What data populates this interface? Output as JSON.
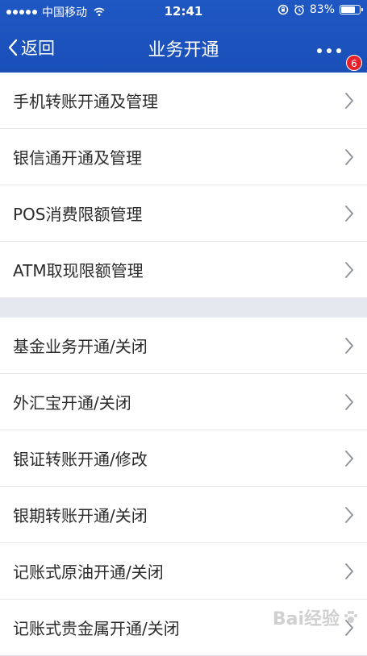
{
  "status_bar": {
    "carrier": "中国移动",
    "time": "12:41",
    "battery": "83%",
    "battery_level": 0.83
  },
  "nav": {
    "back_label": "返回",
    "title": "业务开通",
    "badge_count": "6"
  },
  "sections": [
    {
      "items": [
        {
          "label": "手机转账开通及管理"
        },
        {
          "label": "银信通开通及管理"
        },
        {
          "label": "POS消费限额管理"
        },
        {
          "label": "ATM取现限额管理"
        }
      ]
    },
    {
      "items": [
        {
          "label": "基金业务开通/关闭"
        },
        {
          "label": "外汇宝开通/关闭"
        },
        {
          "label": "银证转账开通/修改"
        },
        {
          "label": "银期转账开通/关闭"
        },
        {
          "label": "记账式原油开通/关闭"
        },
        {
          "label": "记账式贵金属开通/关闭"
        }
      ]
    }
  ],
  "watermark": {
    "text": "Bai经验"
  },
  "colors": {
    "header": "#1a4fb8",
    "section_gap": "#e6e8ef",
    "badge": "#e8202a"
  }
}
